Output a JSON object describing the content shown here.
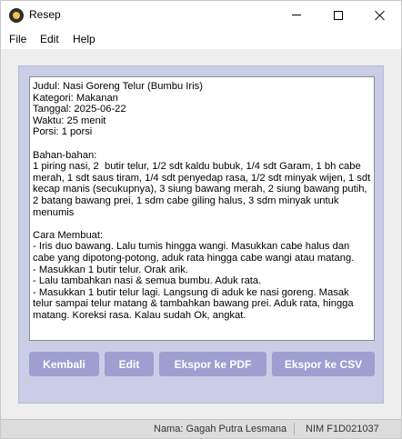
{
  "window": {
    "title": "Resep",
    "app_icon": "app-icon"
  },
  "menu": {
    "file": "File",
    "edit": "Edit",
    "help": "Help"
  },
  "content": {
    "text": "Judul: Nasi Goreng Telur (Bumbu Iris)\nKategori: Makanan\nTanggal: 2025-06-22\nWaktu: 25 menit\nPorsi: 1 porsi\n\nBahan-bahan:\n1 piring nasi, 2  butir telur, 1/2 sdt kaldu bubuk, 1/4 sdt Garam, 1 bh cabe merah, 1 sdt saus tiram, 1/4 sdt penyedap rasa, 1/2 sdt minyak wijen, 1 sdt kecap manis (secukupnya), 3 siung bawang merah, 2 siung bawang putih, 2 batang bawang prei, 1 sdm cabe giling halus, 3 sdm minyak untuk menumis\n\nCara Membuat:\n- Iris duo bawang. Lalu tumis hingga wangi. Masukkan cabe halus dan cabe yang dipotong-potong, aduk rata hingga cabe wangi atau matang.\n- Masukkan 1 butir telur. Orak arik.\n- Lalu tambahkan nasi & semua bumbu. Aduk rata.\n- Masukkan 1 butir telur lagi. Langsung di aduk ke nasi goreng. Masak telur sampai telur matang & tambahkan bawang prei. Aduk rata, hingga matang. Koreksi rasa. Kalau sudah Ok, angkat."
  },
  "buttons": {
    "back": "Kembali",
    "edit": "Edit",
    "export_pdf": "Ekspor ke PDF",
    "export_csv": "Ekspor ke CSV"
  },
  "status": {
    "name": "Nama: Gagah Putra Lesmana",
    "nim": "NIM F1D021037"
  },
  "colors": {
    "panel": "#c9cde6",
    "button": "#9c9fd0",
    "button_text": "#ffffff"
  }
}
